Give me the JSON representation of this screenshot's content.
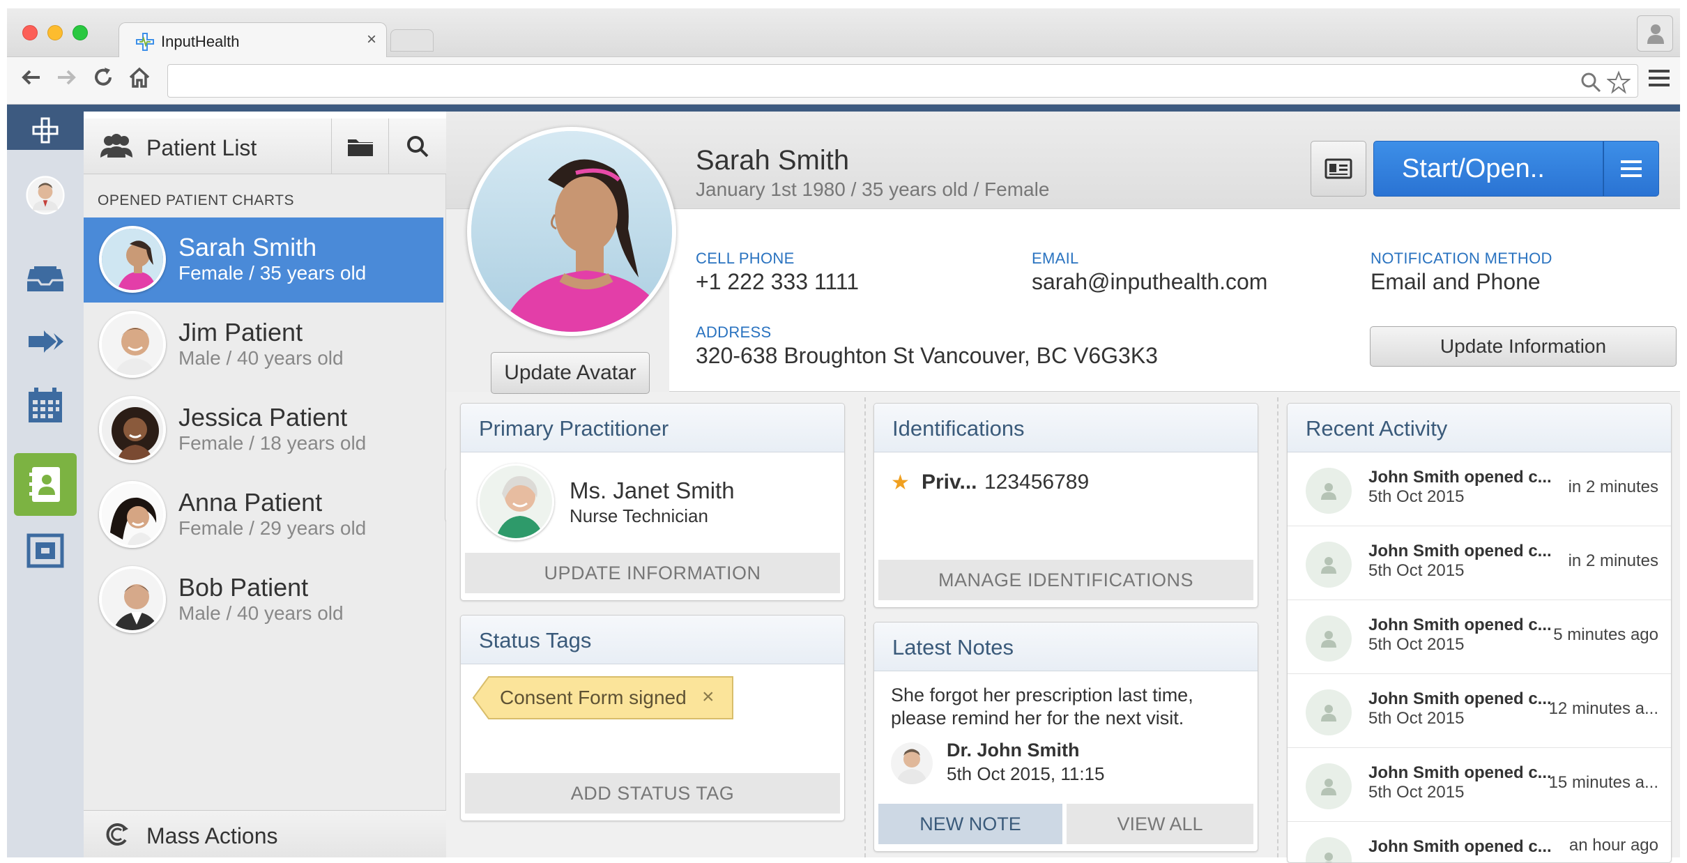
{
  "browser": {
    "tab_title": "InputHealth",
    "tab_close": "×"
  },
  "patient_list": {
    "title": "Patient List",
    "section_label": "OPENED PATIENT CHARTS",
    "patients": [
      {
        "name": "Sarah Smith",
        "sub": "Female / 35 years old",
        "active": true
      },
      {
        "name": "Jim Patient",
        "sub": "Male / 40 years old",
        "active": false
      },
      {
        "name": "Jessica Patient",
        "sub": "Female / 18 years old",
        "active": false
      },
      {
        "name": "Anna Patient",
        "sub": "Female / 29 years old",
        "active": false
      },
      {
        "name": "Bob Patient",
        "sub": "Male / 40 years old",
        "active": false
      }
    ],
    "mass_actions": "Mass Actions"
  },
  "patient": {
    "name": "Sarah Smith",
    "dob": "January 1st 1980 / 35 years old / Female",
    "update_avatar": "Update Avatar",
    "start_open": "Start/Open..",
    "cell_label": "CELL PHONE",
    "cell_value": "+1 222 333 1111",
    "email_label": "EMAIL",
    "email_value": "sarah@inputhealth.com",
    "notif_label": "NOTIFICATION METHOD",
    "notif_value": "Email and Phone",
    "address_label": "ADDRESS",
    "address_value": "320-638 Broughton St Vancouver, BC V6G3K3",
    "update_information": "Update Information"
  },
  "practitioner": {
    "title": "Primary Practitioner",
    "name": "Ms. Janet Smith",
    "role": "Nurse Technician",
    "button": "UPDATE INFORMATION"
  },
  "status_tags": {
    "title": "Status Tags",
    "tags": [
      "Consent Form signed"
    ],
    "remove": "×",
    "button": "ADD STATUS TAG"
  },
  "identifications": {
    "title": "Identifications",
    "items": [
      {
        "type": "Priv...",
        "value": "123456789"
      }
    ],
    "star": "★",
    "button": "MANAGE IDENTIFICATIONS"
  },
  "notes": {
    "title": "Latest Notes",
    "text": "She forgot her prescription last time, please remind her for the next visit.",
    "author": "Dr. John Smith",
    "date": "5th Oct 2015, 11:15",
    "new_note": "NEW NOTE",
    "view_all": "VIEW ALL"
  },
  "activity": {
    "title": "Recent Activity",
    "items": [
      {
        "name": "John Smith opened c...",
        "date": "5th Oct 2015",
        "time": "in 2 minutes"
      },
      {
        "name": "John Smith opened c...",
        "date": "5th Oct 2015",
        "time": "in 2 minutes"
      },
      {
        "name": "John Smith opened c...",
        "date": "5th Oct 2015",
        "time": "5 minutes ago"
      },
      {
        "name": "John Smith opened c...",
        "date": "5th Oct 2015",
        "time": "12 minutes a..."
      },
      {
        "name": "John Smith opened c...",
        "date": "5th Oct 2015",
        "time": "15 minutes a..."
      },
      {
        "name": "John Smith opened c...",
        "date": "",
        "time": "an hour ago"
      }
    ]
  },
  "colors": {
    "accent": "#3d5a80",
    "active_row": "#4a8ad8",
    "primary_button": "#2f7ddc",
    "rail_active": "#7cb342",
    "label_blue": "#2a73c0",
    "tag": "#fbe49a"
  }
}
